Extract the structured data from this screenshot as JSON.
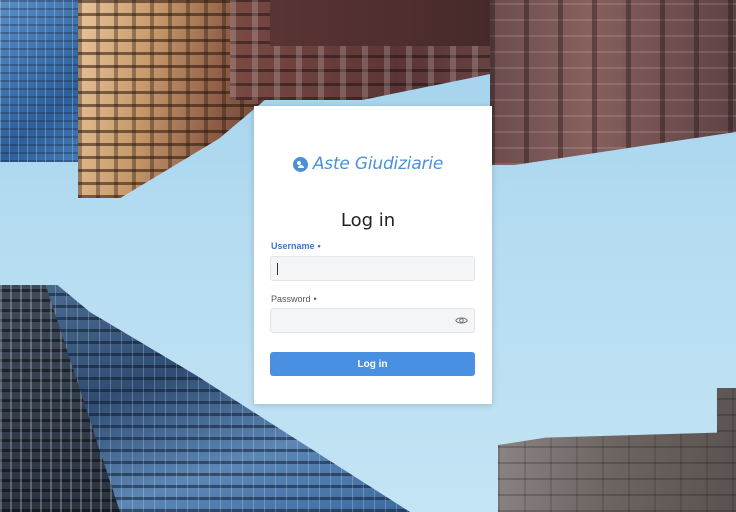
{
  "brand": {
    "name": "Aste Giudiziarie",
    "logo_icon": "gavel-person-icon",
    "accent_color": "#4a90d9"
  },
  "login": {
    "title": "Log in",
    "username": {
      "label": "Username",
      "required_marker": "•",
      "value": "",
      "placeholder": ""
    },
    "password": {
      "label": "Password",
      "required_marker": "•",
      "value": "",
      "placeholder": "",
      "toggle_icon": "eye-icon"
    },
    "submit_label": "Log in",
    "button_color": "#4a90e2"
  }
}
